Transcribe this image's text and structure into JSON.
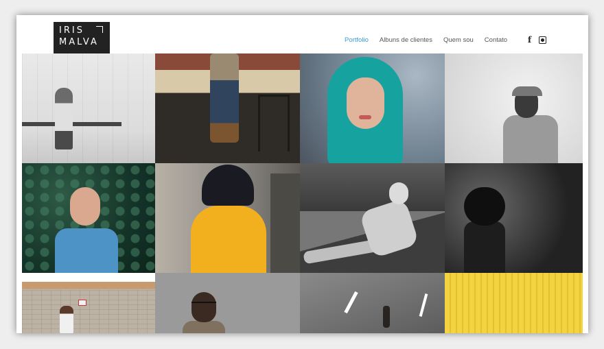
{
  "brand": {
    "line1": "IRIS",
    "line2": "MALVA"
  },
  "nav": {
    "items": [
      {
        "label": "Portfolio",
        "active": true
      },
      {
        "label": "Albuns de clientes",
        "active": false
      },
      {
        "label": "Quem sou",
        "active": false
      },
      {
        "label": "Contato",
        "active": false
      }
    ],
    "social": {
      "facebook": "f"
    }
  },
  "colors": {
    "accent": "#3a9bd8",
    "logo_bg": "#222222"
  },
  "gallery": {
    "photos": [
      "woman-on-bench",
      "person-on-table",
      "teal-hair-woman",
      "man-in-cap",
      "woman-in-leaves",
      "woman-in-yellow-coat",
      "woman-on-street",
      "curly-hair-silhouette",
      "woman-by-brick-wall",
      "man-with-glasses",
      "man-on-road",
      "yellow-wall"
    ]
  }
}
